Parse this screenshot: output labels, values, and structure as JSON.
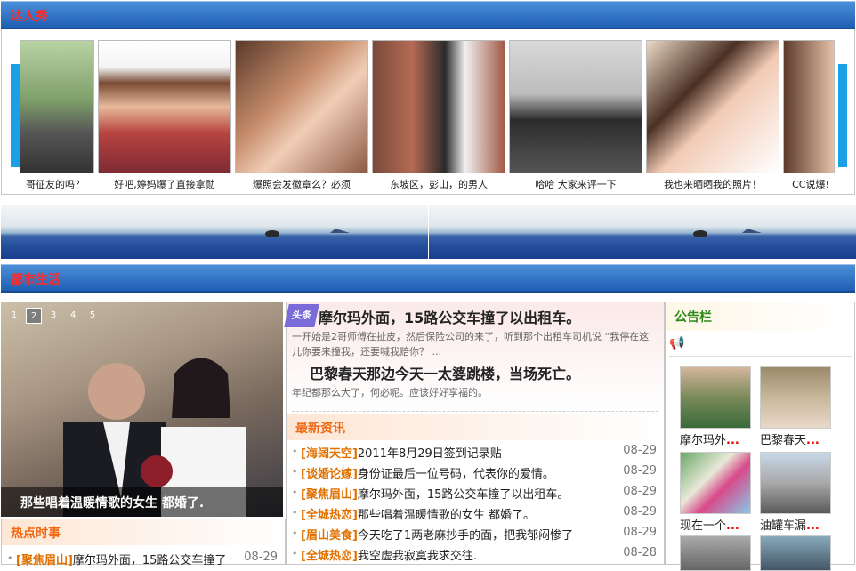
{
  "section1": {
    "title": "达人秀"
  },
  "gallery": [
    {
      "caption": "哥征友的吗？",
      "icon": "memorial-photo"
    },
    {
      "caption": "好吧,婷妈爆了直接拿勋",
      "icon": "girl-photo"
    },
    {
      "caption": "爆照会发徽章么？必须",
      "icon": "girl-photo"
    },
    {
      "caption": "东坡区，彭山，的男人",
      "icon": "girl-camera-photo"
    },
    {
      "caption": "哈哈  大家来评一下",
      "icon": "boy-phone-photo"
    },
    {
      "caption": "我也来晒晒我的照片！",
      "icon": "girl-photo"
    },
    {
      "caption": "CC说爆!",
      "icon": "girl-photo"
    }
  ],
  "section2": {
    "title": "都市生活"
  },
  "slider": {
    "pages": [
      "1",
      "2",
      "3",
      "4",
      "5"
    ],
    "active": "2",
    "caption": "那些唱着温暖情歌的女生  都婚了."
  },
  "headline": {
    "badge": "头条",
    "title1": "摩尔玛外面，15路公交车撞了以出租车。",
    "text1": "一开始是2哥师傅在扯皮，然后保险公司的来了，听到那个出租车司机说 “我停在这儿你要来撞我，还要喊我赔你？ ...",
    "title2": "巴黎春天那边今天一太婆跳楼，当场死亡。",
    "text2": "年纪都那么大了，何必呢。应该好好享福的。"
  },
  "latest": {
    "title": "最新资讯",
    "items": [
      {
        "tag": "[海阔天空]",
        "text": "2011年8月29日签到记录贴",
        "date": "08-29"
      },
      {
        "tag": "[谈婚论嫁]",
        "text": "身份证最后一位号码，代表你的爱情。",
        "date": "08-29"
      },
      {
        "tag": "[聚焦眉山]",
        "text": "摩尔玛外面，15路公交车撞了以出租车。",
        "date": "08-29"
      },
      {
        "tag": "[全城热恋]",
        "text": "那些唱着温暖情歌的女生  都婚了。",
        "date": "08-29"
      },
      {
        "tag": "[眉山美食]",
        "text": "今天吃了1两老麻抄手的面，把我郁闷惨了",
        "date": "08-29"
      },
      {
        "tag": "[全城热恋]",
        "text": "我空虚我寂寞我求交往.",
        "date": "08-28"
      }
    ]
  },
  "hot": {
    "title": "热点时事",
    "item": {
      "tag": "[聚焦眉山]",
      "text": "摩尔玛外面，15路公交车撞了",
      "date": "08-29"
    }
  },
  "notice": {
    "title": "公告栏",
    "thumbs": [
      {
        "caption": "摩尔玛外",
        "dots": "..."
      },
      {
        "caption": "巴黎春天",
        "dots": "..."
      },
      {
        "caption": "现在一个",
        "dots": "..."
      },
      {
        "caption": "油罐车漏",
        "dots": "..."
      }
    ]
  },
  "colors": {
    "bar": "#2a6cc3",
    "title_red": "#ff2a2a",
    "orange": "#ee6a14",
    "notice_green": "#2d8a18"
  }
}
